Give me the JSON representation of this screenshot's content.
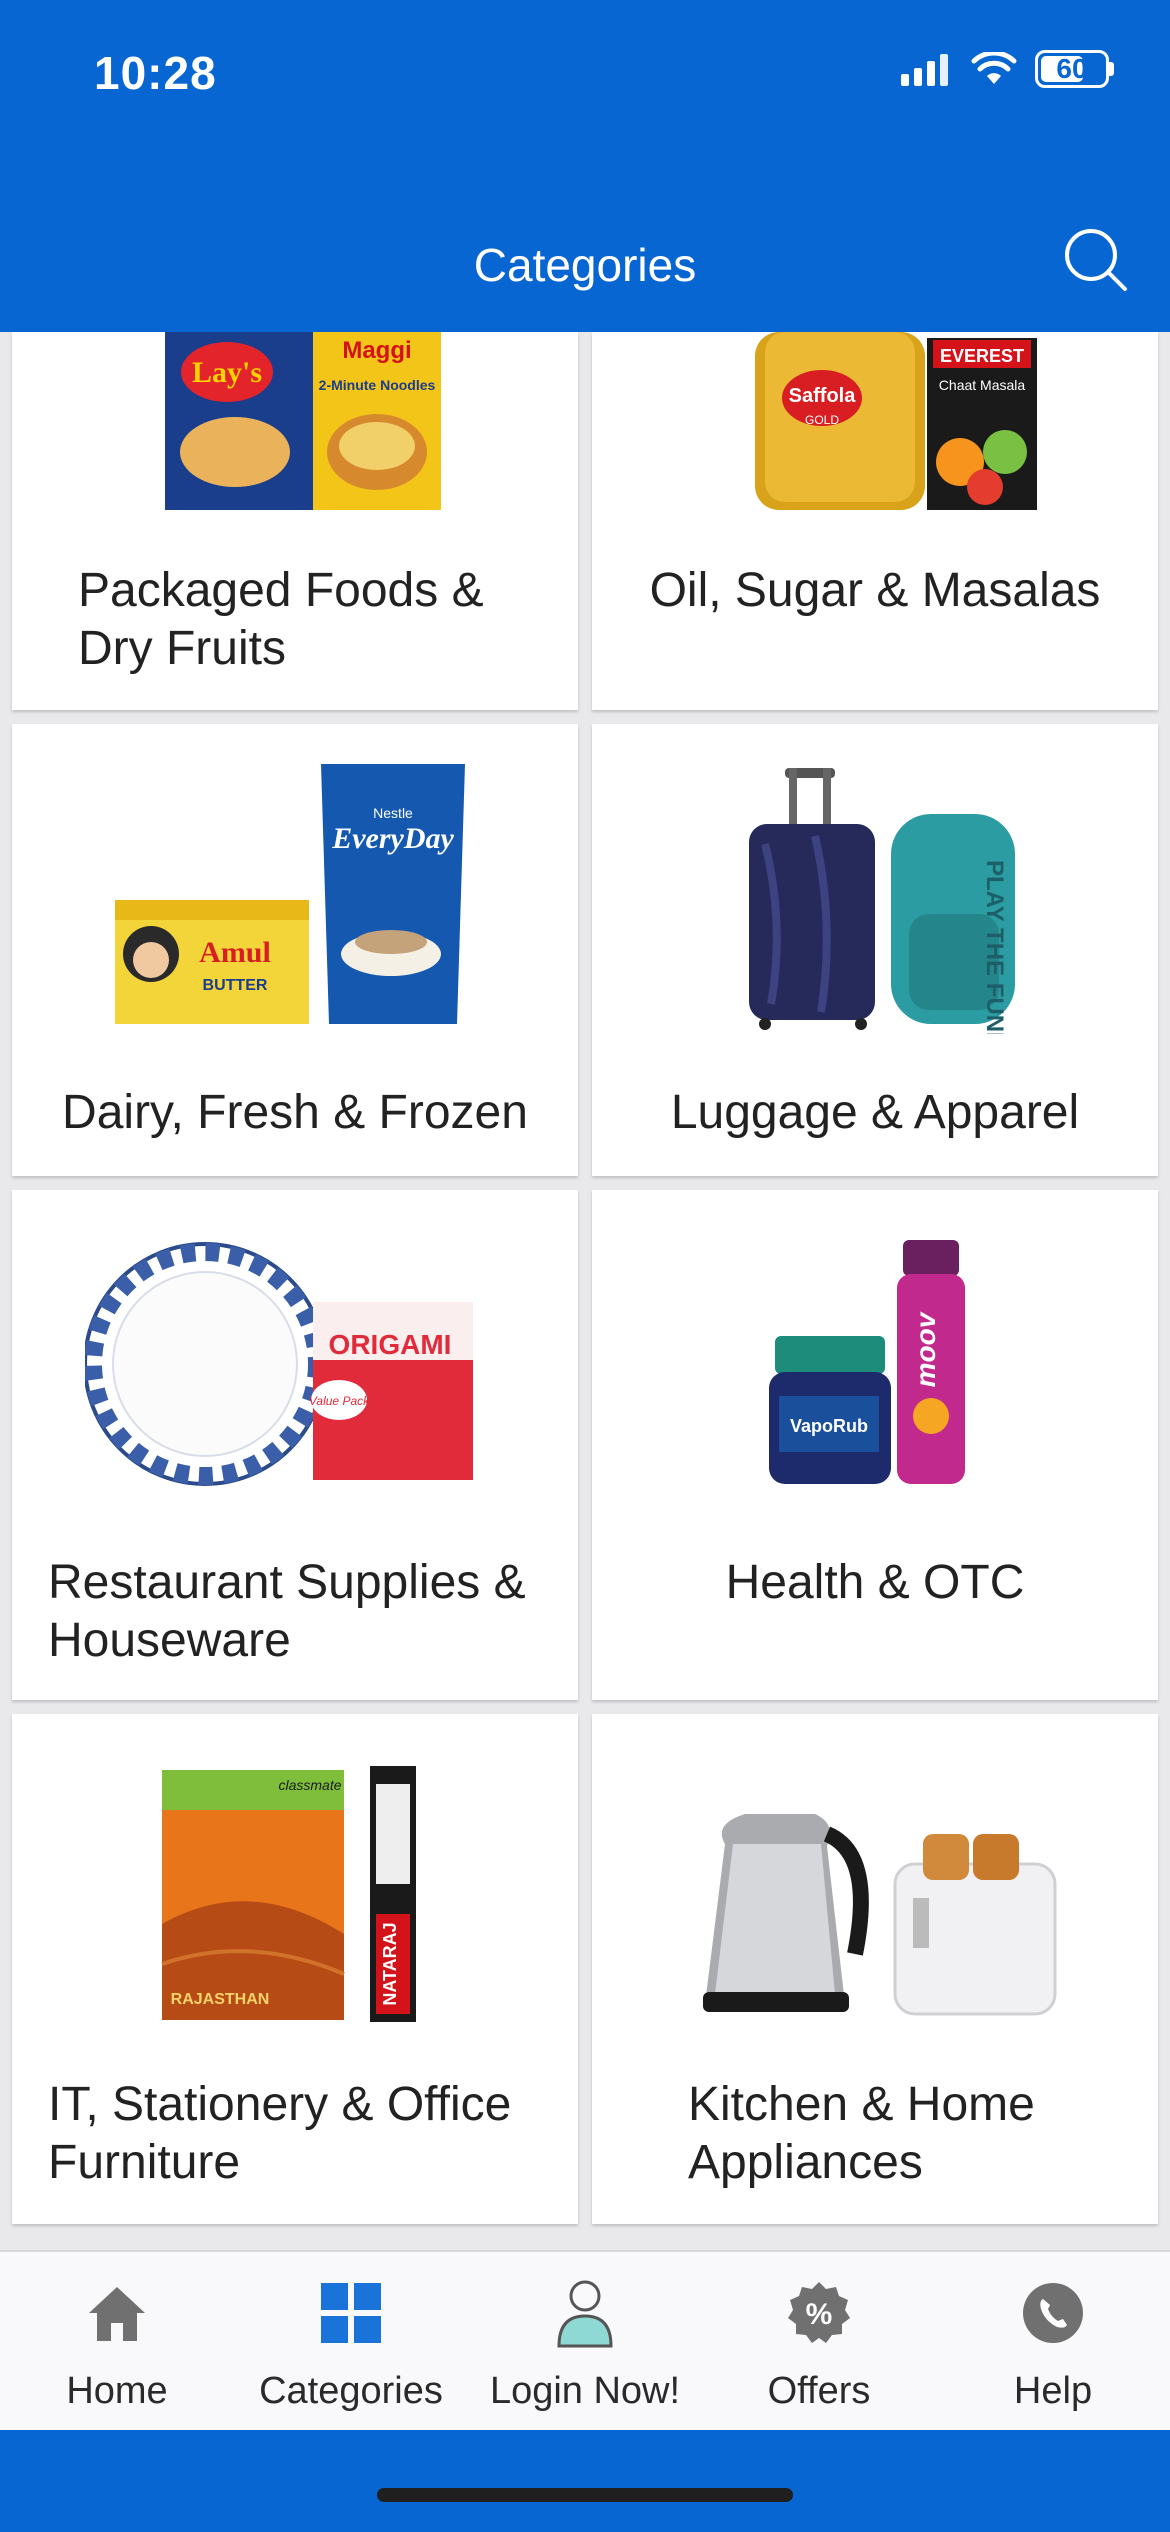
{
  "status": {
    "time": "10:28",
    "battery": "60"
  },
  "header": {
    "title": "Categories"
  },
  "categories": [
    {
      "label_line1": "Packaged Foods &",
      "label_line2": "Dry Fruits"
    },
    {
      "label_line1": "Oil, Sugar & Masalas",
      "label_line2": ""
    },
    {
      "label_line1": "Dairy, Fresh & Frozen",
      "label_line2": ""
    },
    {
      "label_line1": "Luggage & Apparel",
      "label_line2": ""
    },
    {
      "label_line1": "Restaurant Supplies &",
      "label_line2": "Houseware"
    },
    {
      "label_line1": "Health & OTC",
      "label_line2": ""
    },
    {
      "label_line1": "IT, Stationery & Office",
      "label_line2": "Furniture"
    },
    {
      "label_line1": "Kitchen & Home",
      "label_line2": "Appliances"
    }
  ],
  "product_text": {
    "lays": "Lay's",
    "maggi": "Maggi",
    "maggi_sub": "2-Minute Noodles",
    "saffola": "Saffola",
    "saffola_sub": "GOLD",
    "everest": "EVEREST",
    "everest_sub": "Chaat Masala",
    "amul": "Amul",
    "amul_sub": "BUTTER",
    "nestle": "Nestle",
    "everyday": "EveryDay",
    "backpack": "PLAY THE FUNKY MUSIC",
    "origami": "ORIGAMI",
    "origami_sub": "Value Pack",
    "vaporub": "VapoRub",
    "moov": "moov",
    "classmate": "classmate",
    "rajasthan": "RAJASTHAN",
    "nataraj": "NATARAJ"
  },
  "tabs": [
    {
      "label": "Home",
      "icon": "home-icon"
    },
    {
      "label": "Categories",
      "icon": "categories-icon"
    },
    {
      "label": "Login Now!",
      "icon": "user-icon"
    },
    {
      "label": "Offers",
      "icon": "offers-icon"
    },
    {
      "label": "Help",
      "icon": "help-icon"
    }
  ],
  "colors": {
    "brand": "#0866d3",
    "tab_active": "#1a73d9",
    "tab_icon": "#707070"
  }
}
